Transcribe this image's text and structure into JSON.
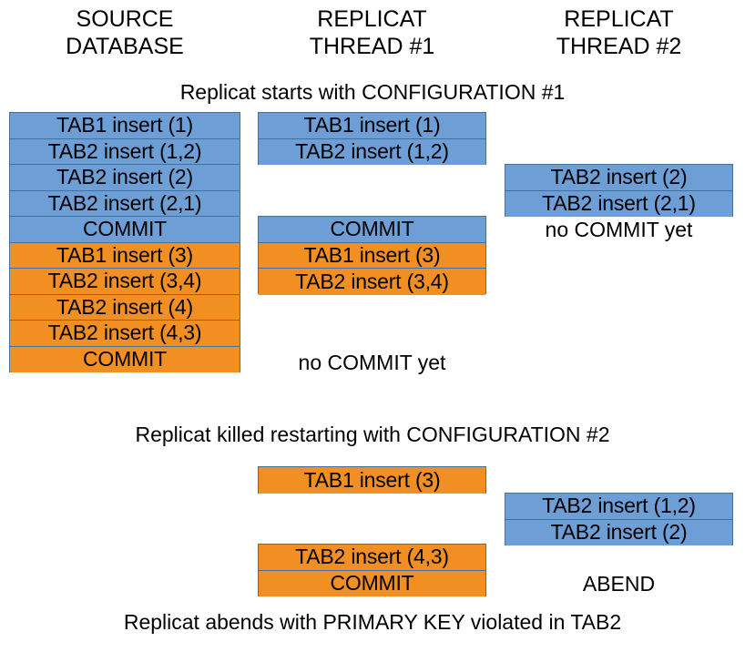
{
  "columns": [
    {
      "title": "SOURCE\nDATABASE"
    },
    {
      "title": "REPLICAT\nTHREAD #1"
    },
    {
      "title": "REPLICAT\nTHREAD #2"
    }
  ],
  "captions": {
    "top": "Replicat starts with CONFIGURATION #1",
    "middle": "Replicat killed restarting with CONFIGURATION #2",
    "bottom": "Replicat abends with PRIMARY KEY violated in TAB2"
  },
  "colors": {
    "transaction_1": "#6d9ed6",
    "transaction_2": "#f18f23",
    "block_border": "#41719c",
    "text": "#000000",
    "background": "#ffffff"
  },
  "phase1": {
    "source_database": {
      "rows": [
        {
          "label": "TAB1 insert (1)",
          "color": "blue"
        },
        {
          "label": "TAB2 insert (1,2)",
          "color": "blue"
        },
        {
          "label": "TAB2 insert (2)",
          "color": "blue"
        },
        {
          "label": "TAB2 insert (2,1)",
          "color": "blue"
        },
        {
          "label": "COMMIT",
          "color": "blue"
        },
        {
          "label": "TAB1 insert (3)",
          "color": "orange"
        },
        {
          "label": "TAB2 insert (3,4)",
          "color": "orange"
        },
        {
          "label": "TAB2 insert (4)",
          "color": "orange"
        },
        {
          "label": "TAB2 insert (4,3)",
          "color": "orange"
        },
        {
          "label": "COMMIT",
          "color": "orange"
        }
      ]
    },
    "replicat_thread_1": {
      "group_a": [
        {
          "label": "TAB1 insert (1)",
          "color": "blue"
        },
        {
          "label": "TAB2 insert (1,2)",
          "color": "blue"
        }
      ],
      "group_b": [
        {
          "label": "COMMIT",
          "color": "blue"
        },
        {
          "label": "TAB1 insert (3)",
          "color": "orange"
        },
        {
          "label": "TAB2 insert (3,4)",
          "color": "orange"
        }
      ],
      "note": "no COMMIT yet"
    },
    "replicat_thread_2": {
      "group_a": [
        {
          "label": "TAB2 insert (2)",
          "color": "blue"
        },
        {
          "label": "TAB2 insert (2,1)",
          "color": "blue"
        }
      ],
      "note": "no COMMIT yet"
    }
  },
  "phase2": {
    "replicat_thread_1": {
      "group_a": [
        {
          "label": "TAB1 insert (3)",
          "color": "orange"
        }
      ],
      "group_b": [
        {
          "label": "TAB2 insert (4,3)",
          "color": "orange"
        },
        {
          "label": "COMMIT",
          "color": "orange"
        }
      ]
    },
    "replicat_thread_2": {
      "group_a": [
        {
          "label": "TAB2 insert (1,2)",
          "color": "blue"
        },
        {
          "label": "TAB2 insert (2)",
          "color": "blue"
        }
      ],
      "note": "ABEND"
    }
  }
}
